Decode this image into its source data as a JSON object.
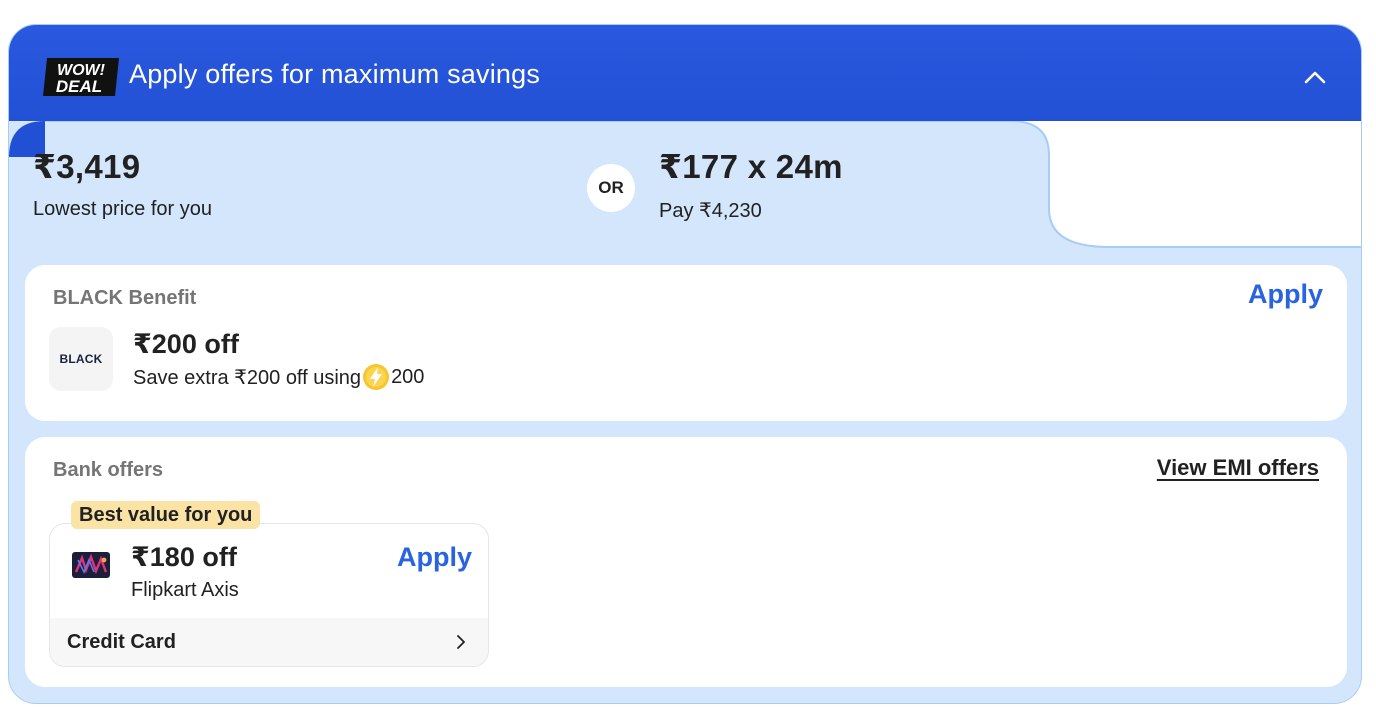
{
  "header": {
    "badge_line1": "WOW!",
    "badge_line2": "DEAL",
    "title": "Apply offers for maximum savings",
    "collapse_icon": "chevron-up-icon"
  },
  "pricing": {
    "lowest_price": "₹3,419",
    "lowest_price_label": "Lowest price for you",
    "or_label": "OR",
    "emi_price": "₹177 x 24m",
    "emi_total": "Pay ₹4,230"
  },
  "black_benefit": {
    "title": "BLACK Benefit",
    "apply_label": "Apply",
    "logo_text": "BLACK",
    "amount": "₹200 off",
    "description": "Save extra ₹200 off using",
    "coin_amount": "200",
    "coin_icon": "lightning-coin-icon"
  },
  "bank_offers": {
    "title": "Bank offers",
    "view_emi_label": "View EMI offers",
    "offers": [
      {
        "badge": "Best value for you",
        "amount": "₹180 off",
        "bank_name": "Flipkart Axis",
        "apply_label": "Apply",
        "card_type": "Credit Card",
        "card_icon": "credit-card-icon",
        "chevron_icon": "chevron-right-icon"
      }
    ]
  },
  "colors": {
    "header_blue": "#2150d4",
    "band_blue": "#d3e6fb",
    "apply_blue": "#2a63e0",
    "badge_yellow": "#fbe3a6"
  }
}
